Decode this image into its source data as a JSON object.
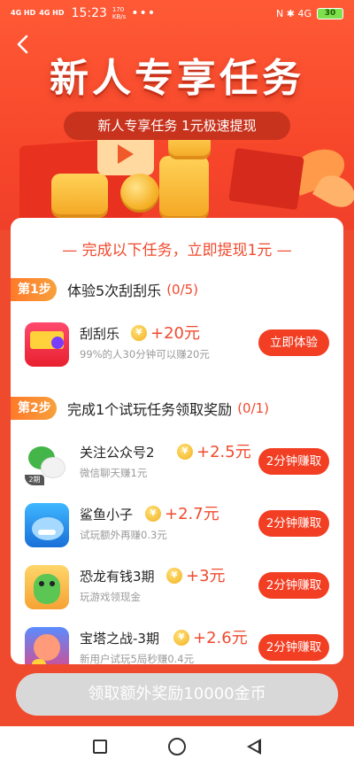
{
  "status_bar": {
    "signal1": "4G HD",
    "signal2": "4G HD",
    "time": "15:23",
    "net_speed_value": "170",
    "net_speed_unit": "KB/s",
    "more": "•••",
    "right_icons": "N ✱ 4G",
    "battery": "30"
  },
  "hero": {
    "title": "新人专享任务",
    "subtitle": "新人专享任务 1元极速提现"
  },
  "card": {
    "header": "— 完成以下任务，立即提现1元 —",
    "step1": {
      "badge": "第1步",
      "text": "体验5次刮刮乐",
      "count": "(0/5)"
    },
    "step2": {
      "badge": "第2步",
      "text": "完成1个试玩任务领取奖励",
      "count": "(0/1)"
    },
    "tasks": [
      {
        "name": "刮刮乐",
        "reward": "+20元",
        "desc": "99%的人30分钟可以赚20元",
        "button": "立即体验",
        "icon": "scratch-card-app-icon"
      },
      {
        "name": "关注公众号2",
        "reward": "+2.5元",
        "desc": "微信聊天赚1元",
        "button": "2分钟赚取",
        "icon": "wechat-icon",
        "icon_tag": "2期"
      },
      {
        "name": "鲨鱼小子",
        "reward": "+2.7元",
        "desc": "试玩额外再赚0.3元",
        "button": "2分钟赚取",
        "icon": "shark-game-icon"
      },
      {
        "name": "恐龙有钱3期",
        "reward": "+3元",
        "desc": "玩游戏领现金",
        "button": "2分钟赚取",
        "icon": "dinosaur-game-icon"
      },
      {
        "name": "宝塔之战-3期",
        "reward": "+2.6元",
        "desc": "新用户试玩5局秒赚0.4元",
        "button": "2分钟赚取",
        "icon": "tower-war-game-icon"
      }
    ],
    "coin_symbol": "¥"
  },
  "bottom_button": "领取额外奖励10000金币",
  "colors": {
    "accent": "#f04a2e",
    "button_red": "#f23e23",
    "step_badge": "#ff7a2a",
    "disabled": "#d8d8d8"
  }
}
